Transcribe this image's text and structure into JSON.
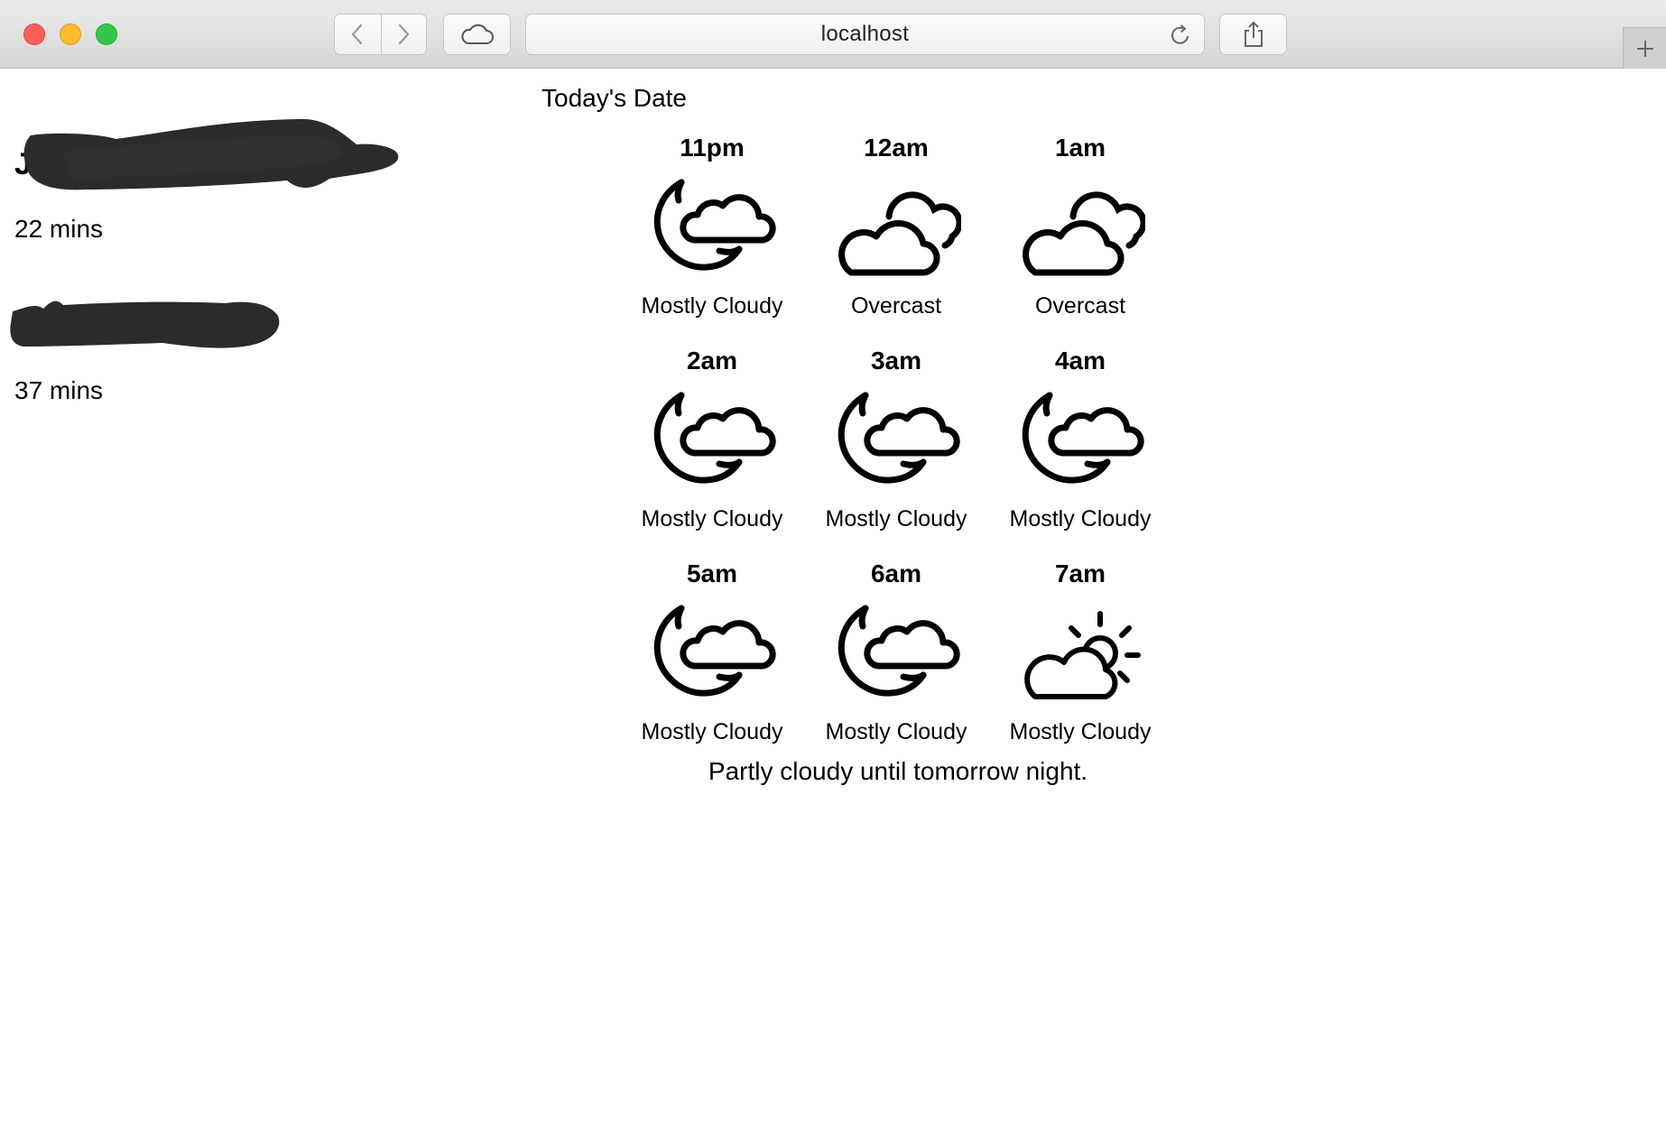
{
  "browser": {
    "url": "localhost"
  },
  "commutes": [
    {
      "name": "J",
      "mins": "22 mins"
    },
    {
      "name": "",
      "mins": "37 mins"
    }
  ],
  "weather": {
    "date_label": "Today's Date",
    "hours": [
      {
        "time": "11pm",
        "condition": "Mostly Cloudy",
        "icon": "moon-cloud-icon"
      },
      {
        "time": "12am",
        "condition": "Overcast",
        "icon": "overcast-icon"
      },
      {
        "time": "1am",
        "condition": "Overcast",
        "icon": "overcast-icon"
      },
      {
        "time": "2am",
        "condition": "Mostly Cloudy",
        "icon": "moon-cloud-icon"
      },
      {
        "time": "3am",
        "condition": "Mostly Cloudy",
        "icon": "moon-cloud-icon"
      },
      {
        "time": "4am",
        "condition": "Mostly Cloudy",
        "icon": "moon-cloud-icon"
      },
      {
        "time": "5am",
        "condition": "Mostly Cloudy",
        "icon": "moon-cloud-icon"
      },
      {
        "time": "6am",
        "condition": "Mostly Cloudy",
        "icon": "moon-cloud-icon"
      },
      {
        "time": "7am",
        "condition": "Mostly Cloudy",
        "icon": "sun-cloud-icon"
      }
    ],
    "summary": "Partly cloudy until tomorrow night."
  }
}
